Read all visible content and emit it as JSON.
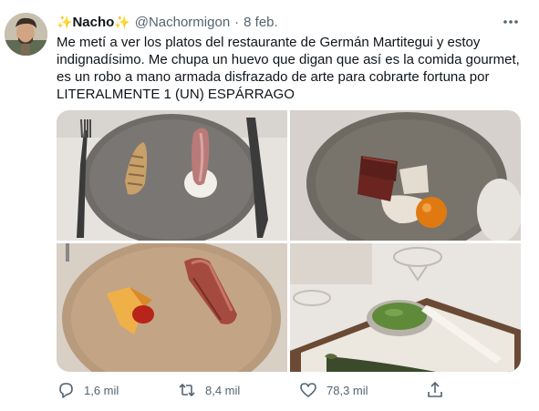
{
  "tweet": {
    "display_name": "Nacho",
    "name_emoji": "✨",
    "handle": "@Nachormigon",
    "separator": "·",
    "date": "8 feb.",
    "more_icon": "more-dots-icon",
    "text_lines": [
      "Me metí a ver los platos del restaurante de Germán Martitegui y estoy",
      "indignadísimo. Me chupa un huevo que digan que así es la comida gourmet,",
      "es un robo a mano armada disfrazado de arte para cobrarte fortuna por",
      "LITERALMENTE 1 (UN) ESPÁRRAGO"
    ],
    "media": {
      "photos": [
        "dish-photo-1",
        "dish-photo-2",
        "dish-photo-3",
        "dish-photo-4"
      ]
    },
    "actions": {
      "reply": {
        "icon": "reply-icon",
        "count": "1,6 mil"
      },
      "retweet": {
        "icon": "retweet-icon",
        "count": "8,4 mil"
      },
      "like": {
        "icon": "heart-icon",
        "count": "78,3 mil"
      },
      "share": {
        "icon": "share-icon"
      }
    }
  },
  "colors": {
    "text_primary": "#0f1419",
    "text_secondary": "#536471",
    "emoji_gold": "#f2b705"
  }
}
